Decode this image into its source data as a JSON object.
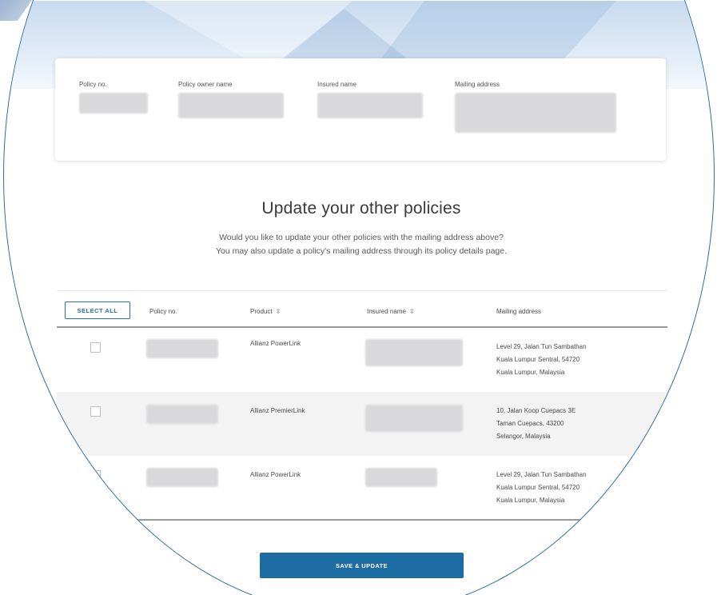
{
  "summary": {
    "policy_no_label": "Policy no.",
    "owner_name_label": "Policy owner name",
    "insured_name_label": "Insured name",
    "mailing_address_label": "Mailing address"
  },
  "section": {
    "title": "Update your other policies",
    "subtitle_line1": "Would you like to update your other policies with the mailing address above?",
    "subtitle_line2": "You may also update a policy's mailing address through its policy details page."
  },
  "table": {
    "select_all_label": "SELECT ALL",
    "columns": {
      "policy_no": "Policy no.",
      "product": "Product",
      "insured_name": "Insured name",
      "mailing_address": "Mailing address"
    },
    "rows": [
      {
        "checked": false,
        "product": "Allianz PowerLink",
        "address_line1": "Level 29, Jalan Tun Sambathan",
        "address_line2": "Kuala Lumpur Sentral, 54720",
        "address_line3": "Kuala Lumpur, Malaysia"
      },
      {
        "checked": false,
        "product": "Allianz PremierLink",
        "address_line1": "10, Jalan Koop Cuepacs 3E",
        "address_line2": "Taman Cuepacs, 43200",
        "address_line3": "Selangor, Malaysia"
      },
      {
        "checked": false,
        "product": "Allianz PowerLink",
        "address_line1": "Level 29, Jalan Tun Sambathan",
        "address_line2": "Kuala Lumpur Sentral, 54720",
        "address_line3": "Kuala Lumpur, Malaysia"
      }
    ]
  },
  "actions": {
    "save_label": "SAVE & UPDATE"
  },
  "colors": {
    "accent": "#1e6ca4",
    "outline": "#2a6fa6",
    "row_alt": "#f3f3f3"
  },
  "icons": {
    "sort": "sort-arrows-icon",
    "checkbox": "checkbox-icon"
  }
}
